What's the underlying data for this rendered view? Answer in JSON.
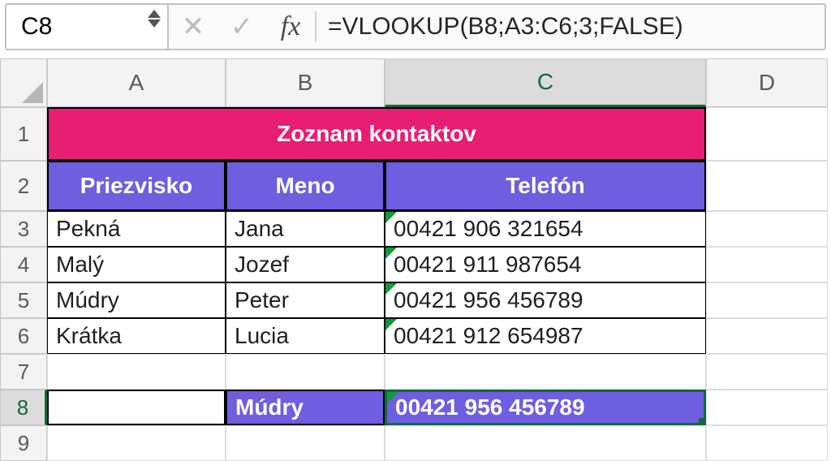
{
  "formula_bar": {
    "cell_ref": "C8",
    "formula": "=VLOOKUP(B8;A3:C6;3;FALSE)"
  },
  "columns": [
    "A",
    "B",
    "C",
    "D"
  ],
  "rows": [
    "1",
    "2",
    "3",
    "4",
    "5",
    "6",
    "7",
    "8",
    "9"
  ],
  "selected_column_index": 2,
  "selected_row_index": 7,
  "title": "Zoznam kontaktov",
  "headers": {
    "surname": "Priezvisko",
    "name": "Meno",
    "phone": "Telefón"
  },
  "data": [
    {
      "surname": "Pekná",
      "name": "Jana",
      "phone": "00421 906 321654"
    },
    {
      "surname": "Malý",
      "name": "Jozef",
      "phone": "00421 911 987654"
    },
    {
      "surname": "Múdry",
      "name": "Peter",
      "phone": "00421 956 456789"
    },
    {
      "surname": "Krátka",
      "name": "Lucia",
      "phone": "00421 912 654987"
    }
  ],
  "lookup": {
    "key": "Múdry",
    "result": "00421 956 456789"
  }
}
